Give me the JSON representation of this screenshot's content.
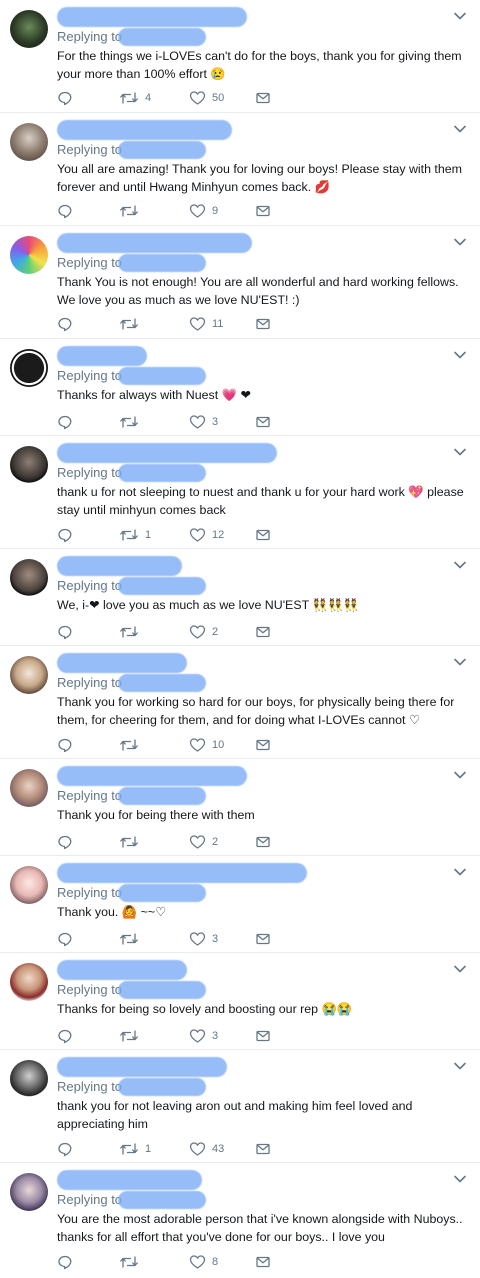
{
  "replying_label": "Replying to",
  "tweets": [
    {
      "text": "For the things we i-LOVEs can't do for the boys, thank you for giving them your more than 100% effort 😢",
      "retweets": "4",
      "likes": "50"
    },
    {
      "text": "You all are amazing! Thank you for loving our boys! Please stay with them forever and until Hwang Minhyun comes back. 💋",
      "retweets": "",
      "likes": "9"
    },
    {
      "text": "Thank You is not enough! You are all wonderful and hard working fellows. We love you as much as we love NU'EST! :)",
      "retweets": "",
      "likes": "11"
    },
    {
      "text": "Thanks for always with Nuest 💗 ❤",
      "retweets": "",
      "likes": "3"
    },
    {
      "text": "thank u for not sleeping to nuest and thank u for your hard work 💖 please stay until minhyun comes back",
      "retweets": "1",
      "likes": "12"
    },
    {
      "text": "We, i-❤ love you as much as we love NU'EST 👯👯👯",
      "retweets": "",
      "likes": "2"
    },
    {
      "text": "Thank you for working so hard for our boys, for physically being there for them, for cheering for them, and for doing what I-LOVEs cannot ♡",
      "retweets": "",
      "likes": "10"
    },
    {
      "text": "Thank you for being there with them",
      "retweets": "",
      "likes": "2"
    },
    {
      "text": "Thank you. 🙆 ~~♡",
      "retweets": "",
      "likes": "3"
    },
    {
      "text": "Thanks for being so lovely and boosting our rep 😭😭",
      "retweets": "",
      "likes": "3"
    },
    {
      "text": "thank you for not leaving aron out and making him feel loved and appreciating him",
      "retweets": "1",
      "likes": "43"
    },
    {
      "text": "You are the most adorable person that i've known alongside with Nuboys.. thanks for all effort that you've done for our boys.. I love you",
      "retweets": "",
      "likes": "8"
    }
  ],
  "colors": {
    "text": "#14171a",
    "secondary": "#657786",
    "divider": "#e6ecf0",
    "redaction_blue": "#78aaf5"
  },
  "icons": [
    "chevron-down-icon",
    "reply-icon",
    "retweet-icon",
    "like-icon",
    "dm-icon"
  ]
}
